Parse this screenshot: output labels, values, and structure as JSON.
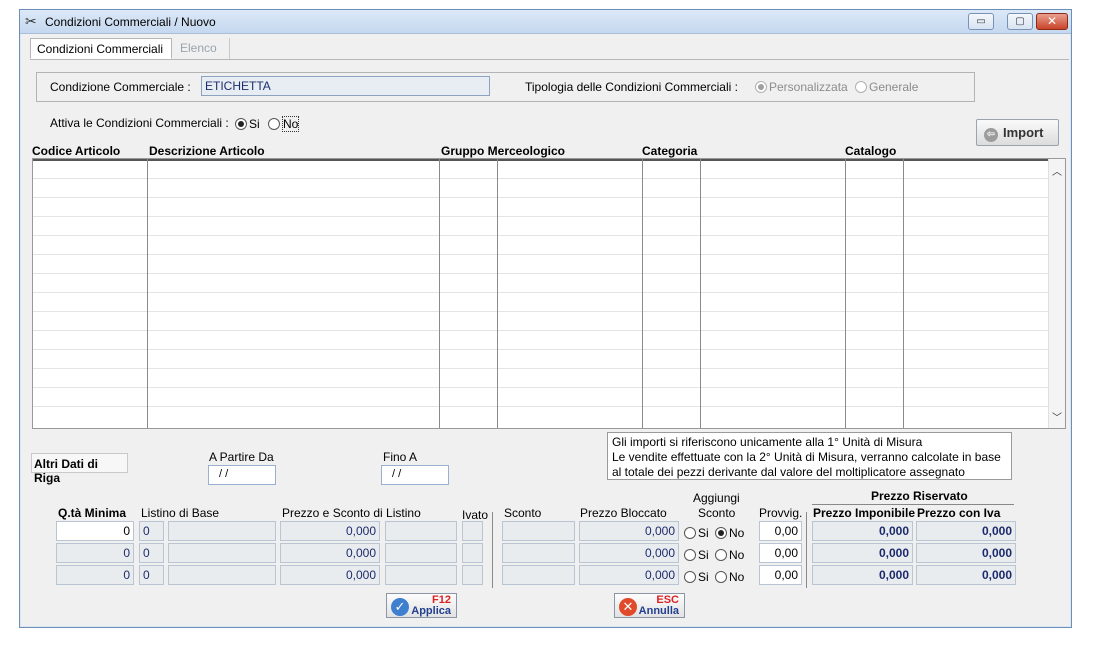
{
  "window": {
    "title": "Condizioni Commerciali / Nuovo",
    "controls": {
      "minimize": "▭",
      "maximize": "▢",
      "close": "✕"
    }
  },
  "tabs": [
    {
      "label": "Condizioni Commerciali",
      "active": true
    },
    {
      "label": "Elenco",
      "active": false
    }
  ],
  "header": {
    "condizione_label": "Condizione Commerciale :",
    "condizione_value": "ETICHETTA",
    "tipologia_label": "Tipologia delle Condizioni Commerciali :",
    "tipologia_options": [
      {
        "label": "Personalizzata",
        "selected": true
      },
      {
        "label": "Generale",
        "selected": false
      }
    ],
    "attiva_label": "Attiva le Condizioni Commerciali :",
    "attiva_options": [
      {
        "label": "Si",
        "selected": true
      },
      {
        "label": "No",
        "selected": false
      }
    ],
    "import_label": "Import"
  },
  "grid": {
    "columns": [
      "Codice Articolo",
      "Descrizione Articolo",
      "Gruppo Merceologico",
      "Categoria",
      "Catalogo"
    ],
    "rows": []
  },
  "details": {
    "altri_dati_label": "Altri Dati di Riga",
    "a_partire_label": "A Partire Da",
    "a_partire_value": "/ /",
    "fino_a_label": "Fino A",
    "fino_a_value": "/ /",
    "info_lines": [
      "Gli importi si riferiscono unicamente alla 1° Unità di Misura",
      "Le vendite effettuate con la 2° Unità di Misura, verranno calcolate in base",
      "al totale dei pezzi derivante dal valore del moltiplicatore assegnato"
    ]
  },
  "price_table": {
    "headers": {
      "qta_minima": "Q.tà Minima",
      "listino_base": "Listino di Base",
      "prezzo_sconto": "Prezzo e Sconto di Listino",
      "ivato": "Ivato",
      "sconto": "Sconto",
      "prezzo_bloccato": "Prezzo Bloccato",
      "aggiungi": "Aggiungi",
      "aggiungi_sconto": "Sconto",
      "provvig": "Provvig.",
      "prezzo_riservato": "Prezzo Riservato",
      "prezzo_imponibile": "Prezzo Imponibile",
      "prezzo_con_iva": "Prezzo con Iva"
    },
    "rows": [
      {
        "qta": "0",
        "listino": "0",
        "prezzo": "0,000",
        "bloccato": "0,000",
        "aggiungi_si": "Si",
        "aggiungi_no": "No",
        "aggiungi_selected": "No",
        "provvig": "0,00",
        "imponibile": "0,000",
        "con_iva": "0,000"
      },
      {
        "qta": "0",
        "listino": "0",
        "prezzo": "0,000",
        "bloccato": "0,000",
        "aggiungi_si": "Si",
        "aggiungi_no": "No",
        "aggiungi_selected": "none",
        "provvig": "0,00",
        "imponibile": "0,000",
        "con_iva": "0,000"
      },
      {
        "qta": "0",
        "listino": "0",
        "prezzo": "0,000",
        "bloccato": "0,000",
        "aggiungi_si": "Si",
        "aggiungi_no": "No",
        "aggiungi_selected": "none",
        "provvig": "0,00",
        "imponibile": "0,000",
        "con_iva": "0,000"
      }
    ]
  },
  "buttons": {
    "apply_key": "F12",
    "apply_label": "Applica",
    "cancel_key": "ESC",
    "cancel_label": "Annulla"
  }
}
